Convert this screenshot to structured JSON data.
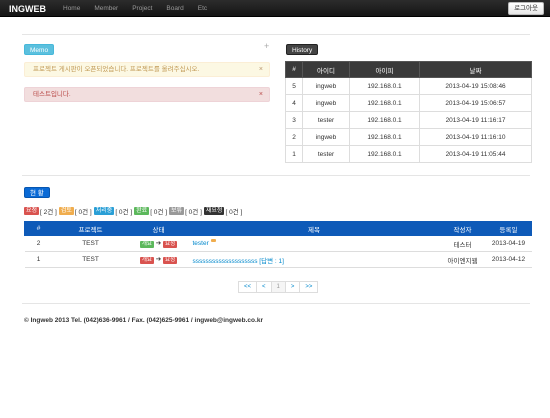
{
  "navbar": {
    "brand": "INGWEB",
    "items": [
      "Home",
      "Member",
      "Project",
      "Board",
      "Etc"
    ],
    "logout_label": "로그아웃"
  },
  "memo": {
    "label": "Memo",
    "plus": "+",
    "alerts": [
      {
        "text": "프로젝트 게시판이 오픈되었습니다. 프로젝트를 올려주십시오.",
        "close": "×"
      },
      {
        "text": "테스트입니다.",
        "close": "×"
      }
    ]
  },
  "history": {
    "label": "History",
    "columns": [
      "#",
      "아이디",
      "아이피",
      "날짜"
    ],
    "rows": [
      [
        "5",
        "ingweb",
        "192.168.0.1",
        "2013-04-19 15:08:46"
      ],
      [
        "4",
        "ingweb",
        "192.168.0.1",
        "2013-04-19 15:06:57"
      ],
      [
        "3",
        "tester",
        "192.168.0.1",
        "2013-04-19 11:16:17"
      ],
      [
        "2",
        "ingweb",
        "192.168.0.1",
        "2013-04-19 11:16:10"
      ],
      [
        "1",
        "tester",
        "192.168.0.1",
        "2013-04-19 11:05:44"
      ]
    ]
  },
  "status": {
    "label": "현 황",
    "summary": [
      {
        "tag": "요청",
        "color": "#d9534f",
        "count": "[ 2건 ]"
      },
      {
        "tag": "검토",
        "color": "#f0ad4e",
        "count": "[ 0건 ]"
      },
      {
        "tag": "처리중",
        "color": "#2a9fd6",
        "count": "[ 0건 ]"
      },
      {
        "tag": "완료",
        "color": "#5cb85c",
        "count": "[ 0건 ]"
      },
      {
        "tag": "보류",
        "color": "#999999",
        "count": "[ 0건 ]"
      },
      {
        "tag": "재요청",
        "color": "#333333",
        "count": "[ 0건 ]"
      }
    ],
    "columns": [
      "#",
      "프로젝트",
      "상태",
      "제목",
      "작성자",
      "등록일"
    ],
    "rows": [
      {
        "num": "2",
        "project": "TEST",
        "from": "개요",
        "from_color": "#5cb85c",
        "arrow": "➔",
        "to": "요청",
        "to_color": "#d9534f",
        "title": "tester",
        "author": "테스터",
        "date": "2013-04-19"
      },
      {
        "num": "1",
        "project": "TEST",
        "from": "개요",
        "from_color": "#d9534f",
        "arrow": "➔",
        "to": "요청",
        "to_color": "#d9534f",
        "title": "ssssssssssssssssssss [답변 : 1]",
        "author": "아이엔지웹",
        "date": "2013-04-12"
      }
    ]
  },
  "pager": [
    "<<",
    "<",
    "1",
    ">",
    ">>"
  ],
  "footer": "© Ingweb 2013 Tel. (042)636-9961 / Fax. (042)625-9961 / ingweb@ingweb.co.kr"
}
